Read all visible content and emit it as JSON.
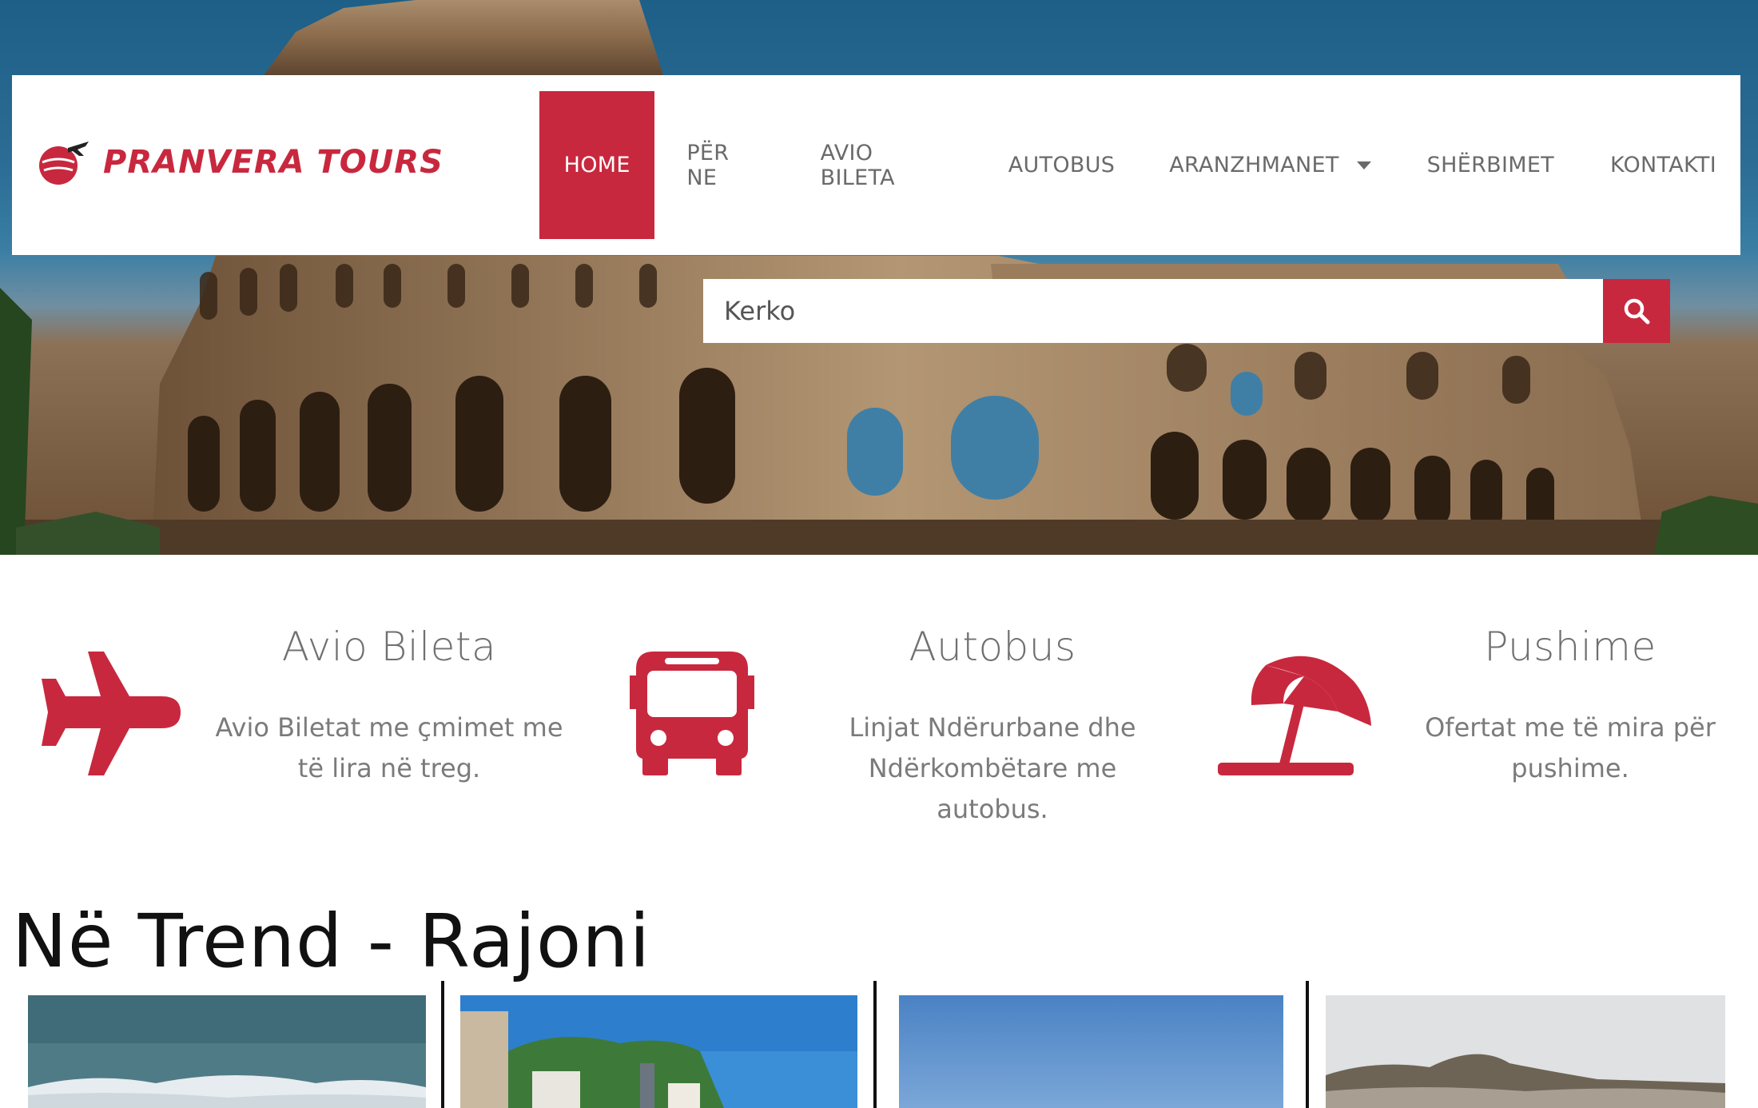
{
  "brand": {
    "name": "PRANVERA TOURS",
    "logo_icon": "globe-plane-icon",
    "accent_color": "#c8283e"
  },
  "nav": {
    "items": [
      {
        "label": "HOME",
        "active": true
      },
      {
        "label": "PËR NE"
      },
      {
        "label": "AVIO BILETA"
      },
      {
        "label": "AUTOBUS"
      },
      {
        "label": "ARANZHMANET",
        "has_dropdown": true
      },
      {
        "label": "SHËRBIMET"
      },
      {
        "label": "KONTAKTI"
      }
    ]
  },
  "search": {
    "placeholder": "Kerko",
    "button_icon": "search-icon"
  },
  "features": [
    {
      "icon": "airplane-icon",
      "title": "Avio Bileta",
      "desc_line1": "Avio Biletat me çmimet me",
      "desc_line2": "të lira në treg."
    },
    {
      "icon": "bus-icon",
      "title": "Autobus",
      "desc_line1": "Linjat Ndërurbane dhe",
      "desc_line2": "Ndërkombëtare me autobus."
    },
    {
      "icon": "umbrella-icon",
      "title": "Pushime",
      "desc_line1": "Ofertat me të mira për",
      "desc_line2": "pushime."
    }
  ],
  "trend": {
    "title": "Në Trend - Rajoni"
  }
}
